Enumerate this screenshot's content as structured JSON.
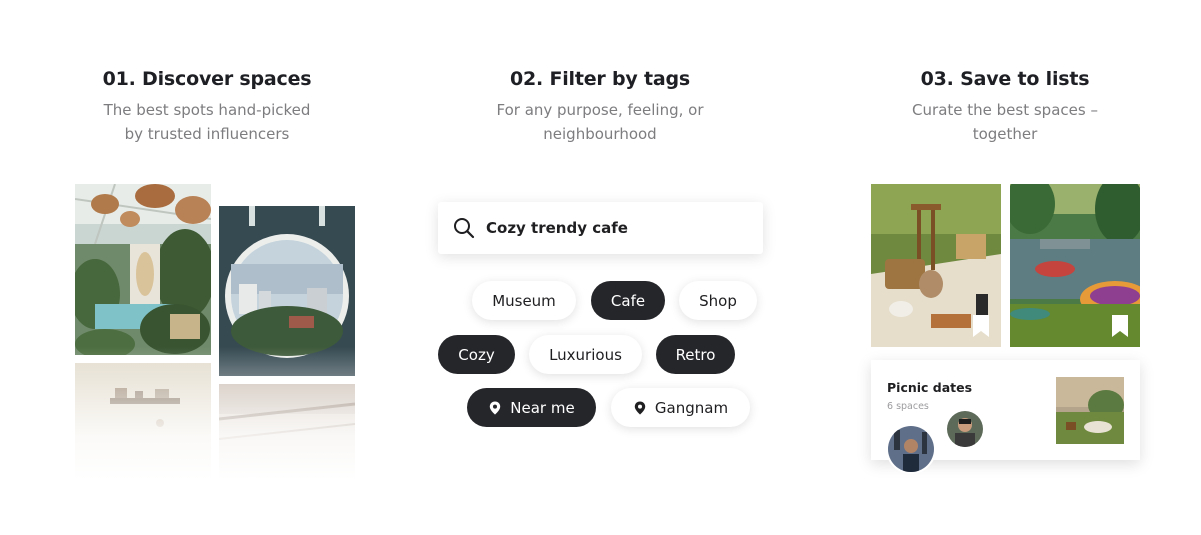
{
  "features": [
    {
      "title": "01. Discover spaces",
      "desc_line1": "The best spots hand-picked",
      "desc_line2": "by trusted influencers"
    },
    {
      "title": "02. Filter by tags",
      "desc_line1": "For any purpose, feeling, or",
      "desc_line2": "neighbourhood"
    },
    {
      "title": "03. Save to lists",
      "desc_line1": "Curate the best spaces –",
      "desc_line2": "together"
    }
  ],
  "search": {
    "value": "Cozy trendy cafe"
  },
  "tags": [
    {
      "label": "Museum",
      "selected": false
    },
    {
      "label": "Cafe",
      "selected": true
    },
    {
      "label": "Shop",
      "selected": false
    },
    {
      "label": "Cozy",
      "selected": true
    },
    {
      "label": "Luxurious",
      "selected": false
    },
    {
      "label": "Retro",
      "selected": true
    },
    {
      "label": "Near me",
      "selected": true,
      "icon": "location-pin-icon"
    },
    {
      "label": "Gangnam",
      "selected": false,
      "icon": "location-pin-icon"
    }
  ],
  "list_card": {
    "title": "Picnic dates",
    "count": "6 spaces"
  },
  "colors": {
    "dark_tag": "#25262a",
    "heading": "#1e1f24",
    "subtext": "#7d7d80"
  }
}
